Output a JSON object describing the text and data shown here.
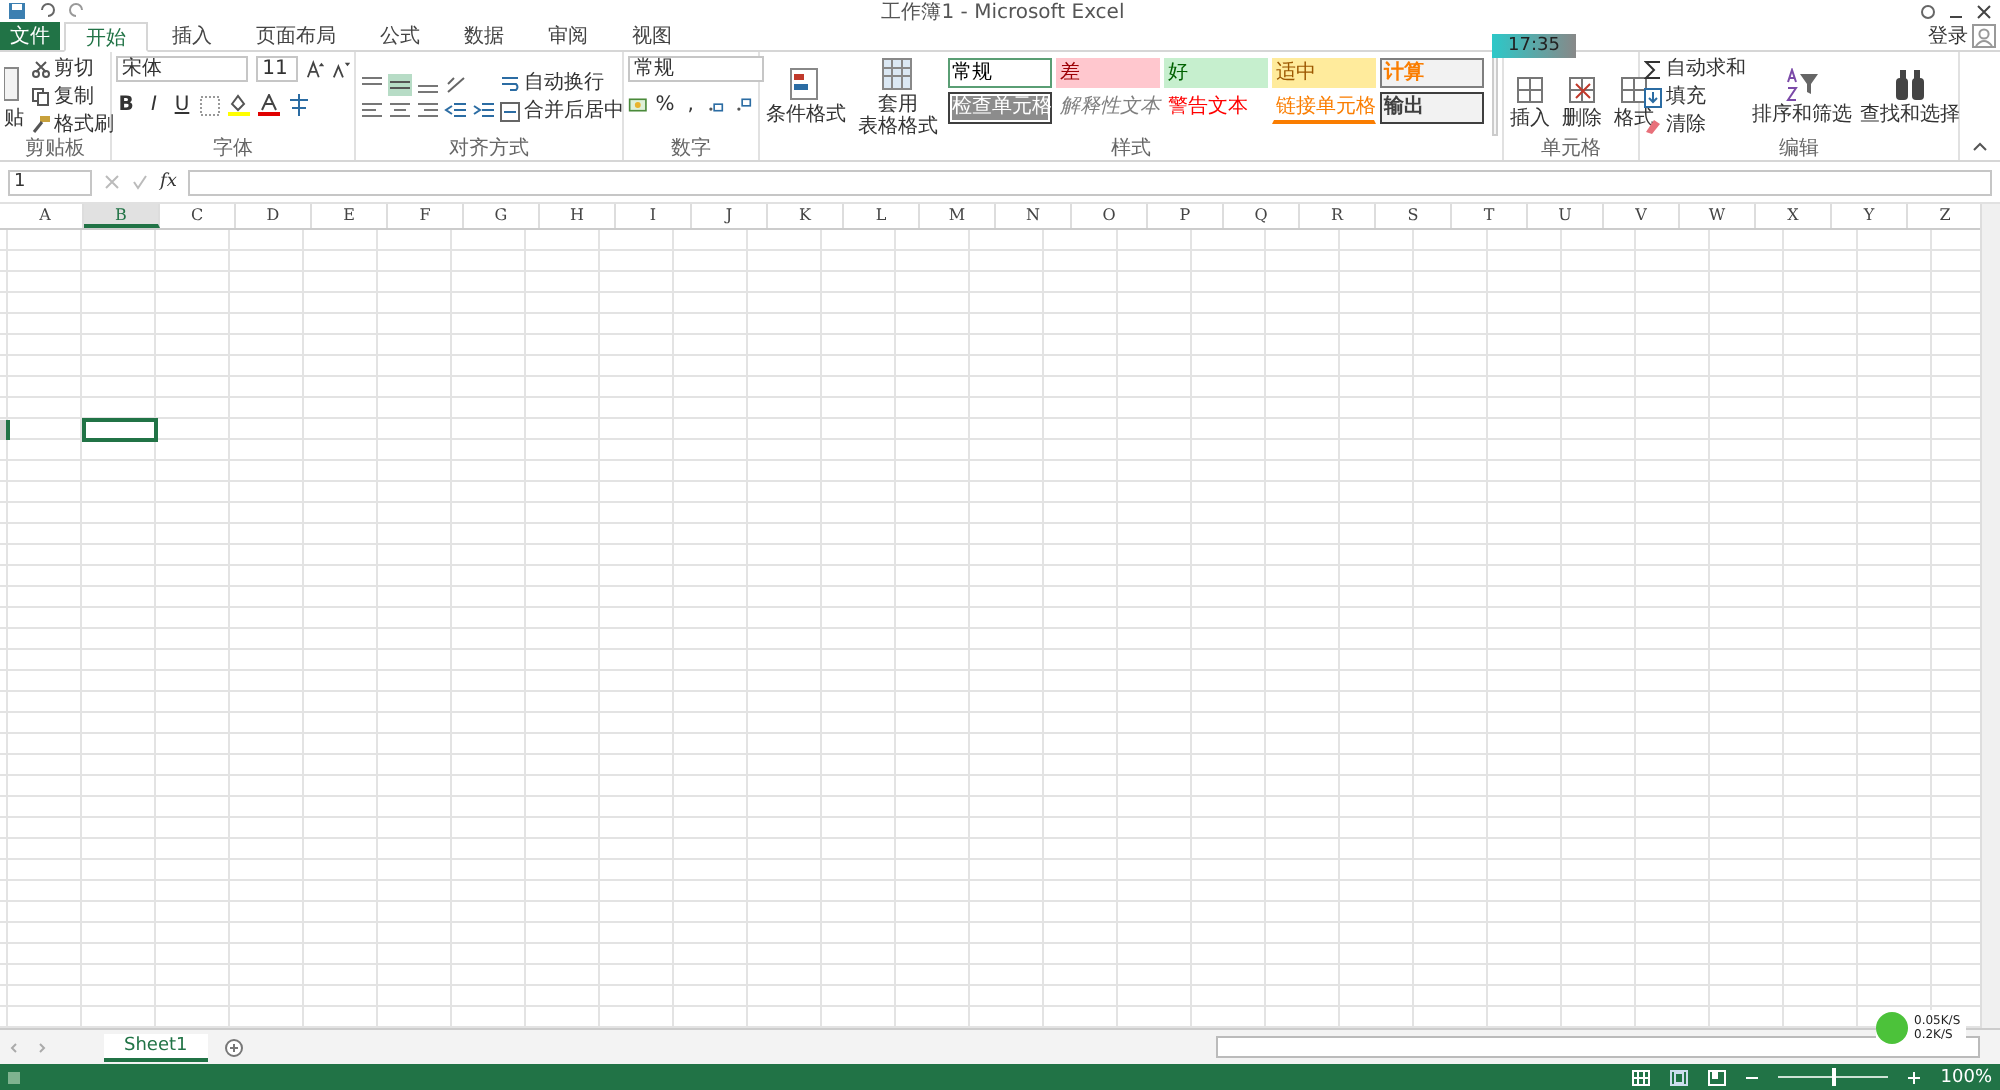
{
  "window": {
    "title": "工作簿1 - Microsoft Excel",
    "account": "登录"
  },
  "ribbon_tabs": [
    {
      "label": "文件",
      "kind": "file",
      "selected": false
    },
    {
      "label": "开始",
      "kind": "tab",
      "selected": true
    },
    {
      "label": "插入",
      "kind": "tab",
      "selected": false
    },
    {
      "label": "页面布局",
      "kind": "tab",
      "selected": false
    },
    {
      "label": "公式",
      "kind": "tab",
      "selected": false
    },
    {
      "label": "数据",
      "kind": "tab",
      "selected": false
    },
    {
      "label": "审阅",
      "kind": "tab",
      "selected": false
    },
    {
      "label": "视图",
      "kind": "tab",
      "selected": false
    }
  ],
  "clipboard": {
    "paste": "贴",
    "cut": "剪切",
    "copy": "复制",
    "format_painter": "格式刷",
    "label": "剪贴板"
  },
  "font": {
    "name": "宋体",
    "size": "11",
    "bold": "B",
    "italic": "I",
    "underline": "U",
    "label": "字体"
  },
  "alignment": {
    "wrap": "自动换行",
    "merge": "合并后居中",
    "label": "对齐方式"
  },
  "number": {
    "format": "常规",
    "percent": "%",
    "comma": ",",
    "label": "数字"
  },
  "styles": {
    "conditional": "条件格式",
    "table_line_1": "套用",
    "table_line_2": "表格格式",
    "label": "样式",
    "gallery": [
      {
        "label": "常规",
        "kind": "normal"
      },
      {
        "label": "差",
        "kind": "bad"
      },
      {
        "label": "好",
        "kind": "good"
      },
      {
        "label": "适中",
        "kind": "neutral"
      },
      {
        "label": "计算",
        "kind": "calculation"
      },
      {
        "label": "检查单元格",
        "kind": "check"
      },
      {
        "label": "解释性文本",
        "kind": "explanatory"
      },
      {
        "label": "警告文本",
        "kind": "warning"
      },
      {
        "label": "链接单元格",
        "kind": "linked"
      },
      {
        "label": "输出",
        "kind": "output"
      }
    ]
  },
  "cells": {
    "items": [
      "插入",
      "删除",
      "格式"
    ],
    "label": "单元格"
  },
  "editing": {
    "autosum": "自动求和",
    "fill": "填充",
    "clear": "清除",
    "sort": "排序和筛选",
    "find": "查找和选择",
    "label": "编辑"
  },
  "formula_bar": {
    "name_box": "1",
    "fx": "fx"
  },
  "columns": [
    {
      "label": "A",
      "selected": false
    },
    {
      "label": "B",
      "selected": true
    },
    {
      "label": "C",
      "selected": false
    },
    {
      "label": "D",
      "selected": false
    },
    {
      "label": "E",
      "selected": false
    },
    {
      "label": "F",
      "selected": false
    },
    {
      "label": "G",
      "selected": false
    },
    {
      "label": "H",
      "selected": false
    },
    {
      "label": "I",
      "selected": false
    },
    {
      "label": "J",
      "selected": false
    },
    {
      "label": "K",
      "selected": false
    },
    {
      "label": "L",
      "selected": false
    },
    {
      "label": "M",
      "selected": false
    },
    {
      "label": "N",
      "selected": false
    },
    {
      "label": "O",
      "selected": false
    },
    {
      "label": "P",
      "selected": false
    },
    {
      "label": "Q",
      "selected": false
    },
    {
      "label": "R",
      "selected": false
    },
    {
      "label": "S",
      "selected": false
    },
    {
      "label": "T",
      "selected": false
    },
    {
      "label": "U",
      "selected": false
    },
    {
      "label": "V",
      "selected": false
    },
    {
      "label": "W",
      "selected": false
    },
    {
      "label": "X",
      "selected": false
    },
    {
      "label": "Y",
      "selected": false
    },
    {
      "label": "Z",
      "selected": false
    }
  ],
  "grid_rows": [
    {
      "selected": false
    },
    {
      "selected": false
    },
    {
      "selected": false
    },
    {
      "selected": false
    },
    {
      "selected": false
    },
    {
      "selected": false
    },
    {
      "selected": false
    },
    {
      "selected": false
    },
    {
      "selected": false
    },
    {
      "selected": true
    },
    {
      "selected": false
    },
    {
      "selected": false
    },
    {
      "selected": false
    },
    {
      "selected": false
    },
    {
      "selected": false
    },
    {
      "selected": false
    },
    {
      "selected": false
    },
    {
      "selected": false
    },
    {
      "selected": false
    },
    {
      "selected": false
    },
    {
      "selected": false
    },
    {
      "selected": false
    },
    {
      "selected": false
    },
    {
      "selected": false
    },
    {
      "selected": false
    },
    {
      "selected": false
    },
    {
      "selected": false
    },
    {
      "selected": false
    },
    {
      "selected": false
    },
    {
      "selected": false
    },
    {
      "selected": false
    },
    {
      "selected": false
    },
    {
      "selected": false
    },
    {
      "selected": false
    },
    {
      "selected": false
    },
    {
      "selected": false
    },
    {
      "selected": false
    },
    {
      "selected": false
    }
  ],
  "sheets": [
    {
      "label": "Sheet1",
      "selected": true
    }
  ],
  "status_bar": {
    "zoom": {
      "label": "100%",
      "level": 0.5
    }
  },
  "clock": "17:35",
  "net_speed": {
    "up": "0.05K/S",
    "down": "0.2K/S"
  }
}
